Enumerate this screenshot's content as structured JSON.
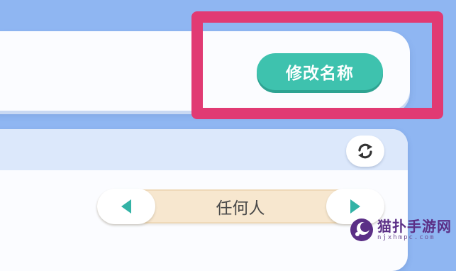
{
  "header": {
    "rename_button_label": "修改名称"
  },
  "panel": {
    "refresh_icon": "refresh-icon",
    "selector": {
      "value": "任何人",
      "prev_icon": "triangle-left-icon",
      "next_icon": "triangle-right-icon"
    }
  },
  "watermark": {
    "title": "猫扑手游网",
    "url": "njxhmpc.com"
  },
  "colors": {
    "background": "#8fb6f2",
    "accent_teal": "#3ec2ae",
    "highlight": "#e13a73",
    "selector_fill": "#f7e7cf",
    "panel_header": "#dce8fb"
  }
}
